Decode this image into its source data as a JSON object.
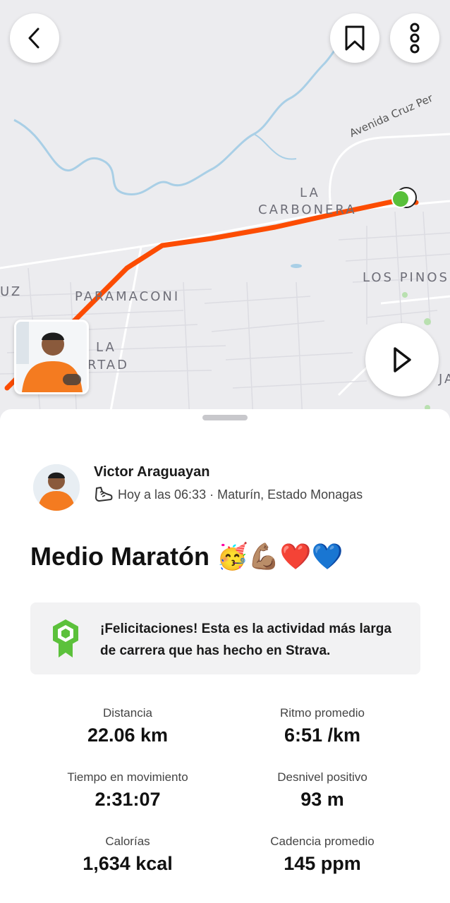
{
  "map": {
    "labels": {
      "la": "LA",
      "carbonera": "CARBONERA",
      "los_pinos": "LOS PINOS",
      "paramaconi": "PARAMACONI",
      "uz": "UZ",
      "la2": "LA",
      "rtad": "RTAD",
      "ja": "JA",
      "road": "Avenida Cruz Per"
    },
    "route_color": "#fc4c02",
    "water_color": "#a9cfe6"
  },
  "buttons": {
    "back": "back-icon",
    "bookmark": "bookmark-icon",
    "more": "more-vertical-icon",
    "play": "play-icon"
  },
  "athlete": {
    "name": "Victor Araguayan",
    "meta": "Hoy a las 06:33 · Maturín, Estado Monagas"
  },
  "activity": {
    "title": "Medio Maratón 🥳💪🏽❤️💙"
  },
  "achievement": {
    "text": "¡Felicitaciones! Esta es la actividad más larga de carrera que has hecho en Strava.",
    "badge_color": "#5cc13b"
  },
  "stats": {
    "distance": {
      "label": "Distancia",
      "value": "22.06 km"
    },
    "pace": {
      "label": "Ritmo promedio",
      "value": "6:51 /km"
    },
    "moving_time": {
      "label": "Tiempo en movimiento",
      "value": "2:31:07"
    },
    "elevation": {
      "label": "Desnivel positivo",
      "value": "93 m"
    },
    "calories": {
      "label": "Calorías",
      "value": "1,634 kcal"
    },
    "cadence": {
      "label": "Cadencia promedio",
      "value": "145 ppm"
    }
  }
}
